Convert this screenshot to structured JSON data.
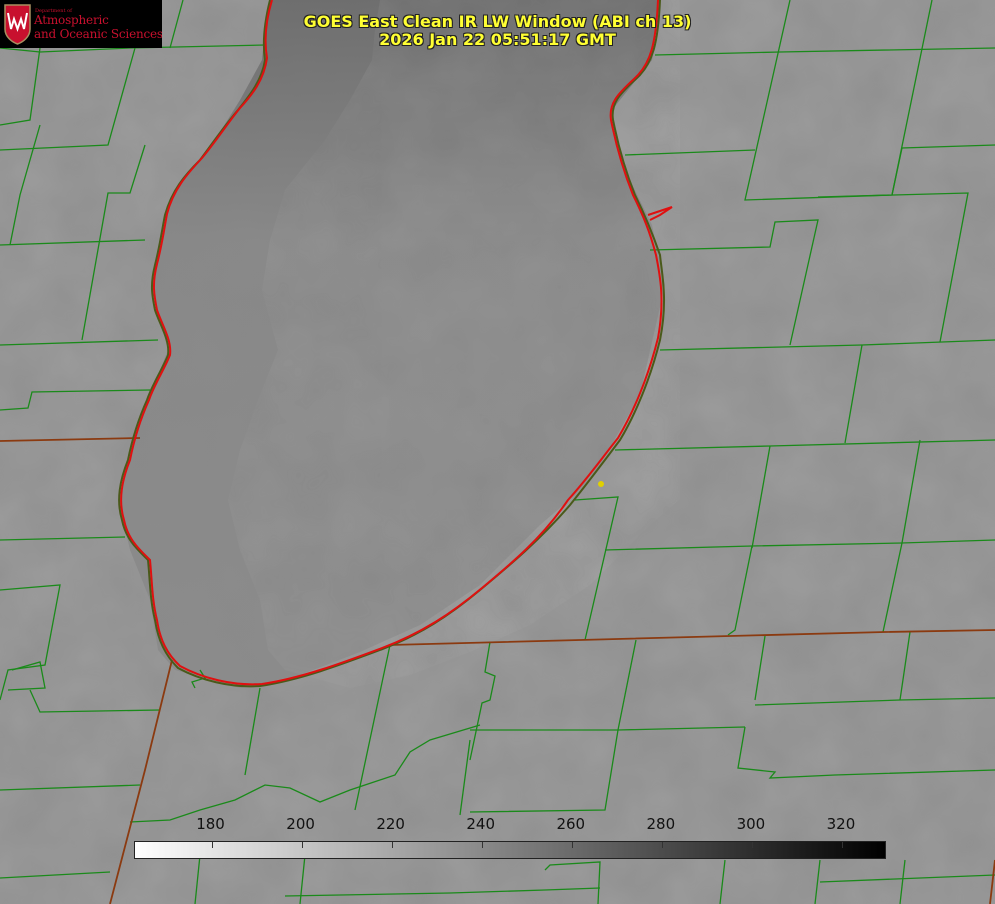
{
  "header": {
    "title": "GOES East Clean IR LW Window (ABI ch 13)",
    "timestamp": "2026 Jan 22 05:51:17 GMT"
  },
  "logo": {
    "department": "Department of",
    "line1": "Atmospheric",
    "line2": "and Oceanic Sciences",
    "seal_letter": "W"
  },
  "colorbar": {
    "ticks": [
      "180",
      "200",
      "220",
      "240",
      "260",
      "280",
      "300",
      "320"
    ],
    "min_value": 163,
    "max_value": 330,
    "gradient": [
      "#ffffff",
      "#000000"
    ]
  },
  "colors": {
    "county_borders": "#1a8a1a",
    "state_borders": "#8b3a10",
    "lake_shoreline": "#e01010",
    "marker": "#e0d000",
    "title": "#ffff33",
    "background": "#8e8e8e"
  },
  "chart_data": {
    "type": "heatmap",
    "title": "GOES East Clean IR LW Window (ABI ch 13)",
    "subtitle": "2026 Jan 22 05:51:17 GMT",
    "colorbar_ticks": [
      180,
      200,
      220,
      240,
      260,
      280,
      300,
      320
    ],
    "colorbar_range": [
      163,
      330
    ],
    "colormap": "white-to-black"
  }
}
